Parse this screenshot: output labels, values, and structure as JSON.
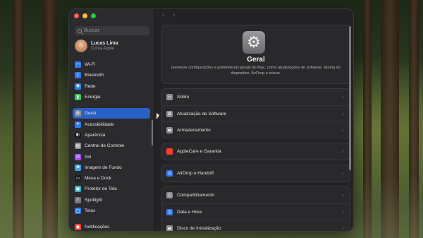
{
  "colors": {
    "selection": "#2a5fc4",
    "close": "#ff5f57",
    "minimize": "#febc2e",
    "zoom": "#28c840"
  },
  "topbar": {
    "back": "‹",
    "forward": "›"
  },
  "search": {
    "placeholder": "Buscar"
  },
  "user": {
    "name": "Lucas Lima",
    "subtitle": "Conta Apple"
  },
  "sidebar": {
    "items": [
      {
        "label": "Wi-Fi",
        "icon": "wifi-icon",
        "color": "#2d7cf6",
        "glyph": "◠"
      },
      {
        "label": "Bluetooth",
        "icon": "bluetooth-icon",
        "color": "#2d7cf6",
        "glyph": "ᛒ"
      },
      {
        "label": "Rede",
        "icon": "network-icon",
        "color": "#2d7cf6",
        "glyph": "◉"
      },
      {
        "label": "Energia",
        "icon": "battery-icon",
        "color": "#34c759",
        "glyph": "▮"
      },
      {
        "label": "Geral",
        "icon": "gear-icon",
        "color": "#8e8e93",
        "glyph": "⚙"
      },
      {
        "label": "Acessibilidade",
        "icon": "accessibility-icon",
        "color": "#2d7cf6",
        "glyph": "✦"
      },
      {
        "label": "Aparência",
        "icon": "appearance-icon",
        "color": "#1c1c1e",
        "glyph": "◐"
      },
      {
        "label": "Central de Controle",
        "icon": "control-center-icon",
        "color": "#8e8e93",
        "glyph": "▤"
      },
      {
        "label": "Siri",
        "icon": "siri-icon",
        "color": "#a34ff0",
        "glyph": "◎"
      },
      {
        "label": "Imagem de Fundo",
        "icon": "wallpaper-icon",
        "color": "#3aa0f0",
        "glyph": "✿"
      },
      {
        "label": "Mesa e Dock",
        "icon": "dock-icon",
        "color": "#1c1c1e",
        "glyph": "▭"
      },
      {
        "label": "Protetor de Tela",
        "icon": "screensaver-icon",
        "color": "#3ab0c8",
        "glyph": "▣"
      },
      {
        "label": "Spotlight",
        "icon": "spotlight-icon",
        "color": "#7a7a80",
        "glyph": "⌕"
      },
      {
        "label": "Telas",
        "icon": "displays-icon",
        "color": "#2d7cf6",
        "glyph": "▢"
      },
      {
        "label": "Notificações",
        "icon": "notifications-icon",
        "color": "#ff3b30",
        "glyph": "●"
      }
    ]
  },
  "hero": {
    "title": "Geral",
    "description": "Gerencie configurações e preferências gerais do Mac, como atualizações de software, idioma do dispositivo, AirDrop e outras."
  },
  "groups": [
    [
      {
        "label": "Sobre",
        "icon": "about-icon",
        "color": "#8e8e93",
        "glyph": "▭"
      },
      {
        "label": "Atualização de Software",
        "icon": "software-update-icon",
        "color": "#8e8e93",
        "glyph": "⚙"
      },
      {
        "label": "Armazenamento",
        "icon": "storage-icon",
        "color": "#8e8e93",
        "glyph": "▬"
      }
    ],
    [
      {
        "label": "AppleCare e Garantia",
        "icon": "applecare-icon",
        "color": "#ff3b30",
        "glyph": ""
      }
    ],
    [
      {
        "label": "AirDrop e Handoff",
        "icon": "airdrop-icon",
        "color": "#2d7cf6",
        "glyph": "◎"
      }
    ],
    [
      {
        "label": "Compartilhamento",
        "icon": "sharing-icon",
        "color": "#8e8e93",
        "glyph": "◇"
      },
      {
        "label": "Data e Hora",
        "icon": "date-time-icon",
        "color": "#2d7cf6",
        "glyph": "◷"
      },
      {
        "label": "Disco de Inicialização",
        "icon": "startup-disk-icon",
        "color": "#8e8e93",
        "glyph": "▬"
      }
    ]
  ],
  "chevron": "›"
}
